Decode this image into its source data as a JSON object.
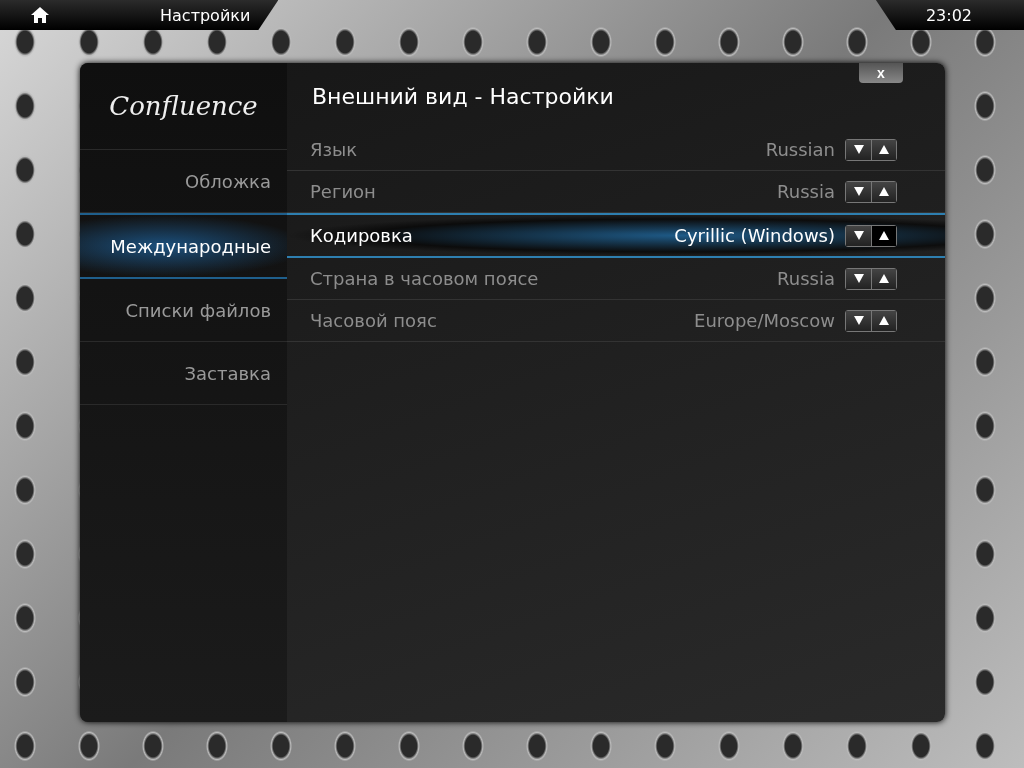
{
  "top_bar": {
    "title": "Настройки",
    "clock": "23:02"
  },
  "dialog": {
    "logo": "Confluence",
    "title": "Внешний вид - Настройки",
    "close": "x"
  },
  "sidebar": {
    "items": [
      {
        "label": "Обложка",
        "selected": false
      },
      {
        "label": "Международные",
        "selected": true
      },
      {
        "label": "Списки файлов",
        "selected": false
      },
      {
        "label": "Заставка",
        "selected": false
      }
    ]
  },
  "settings": [
    {
      "label": "Язык",
      "value": "Russian",
      "selected": false
    },
    {
      "label": "Регион",
      "value": "Russia",
      "selected": false
    },
    {
      "label": "Кодировка",
      "value": "Cyrillic (Windows)",
      "selected": true
    },
    {
      "label": "Страна в часовом поясе",
      "value": "Russia",
      "selected": false
    },
    {
      "label": "Часовой пояс",
      "value": "Europe/Moscow",
      "selected": false
    }
  ]
}
